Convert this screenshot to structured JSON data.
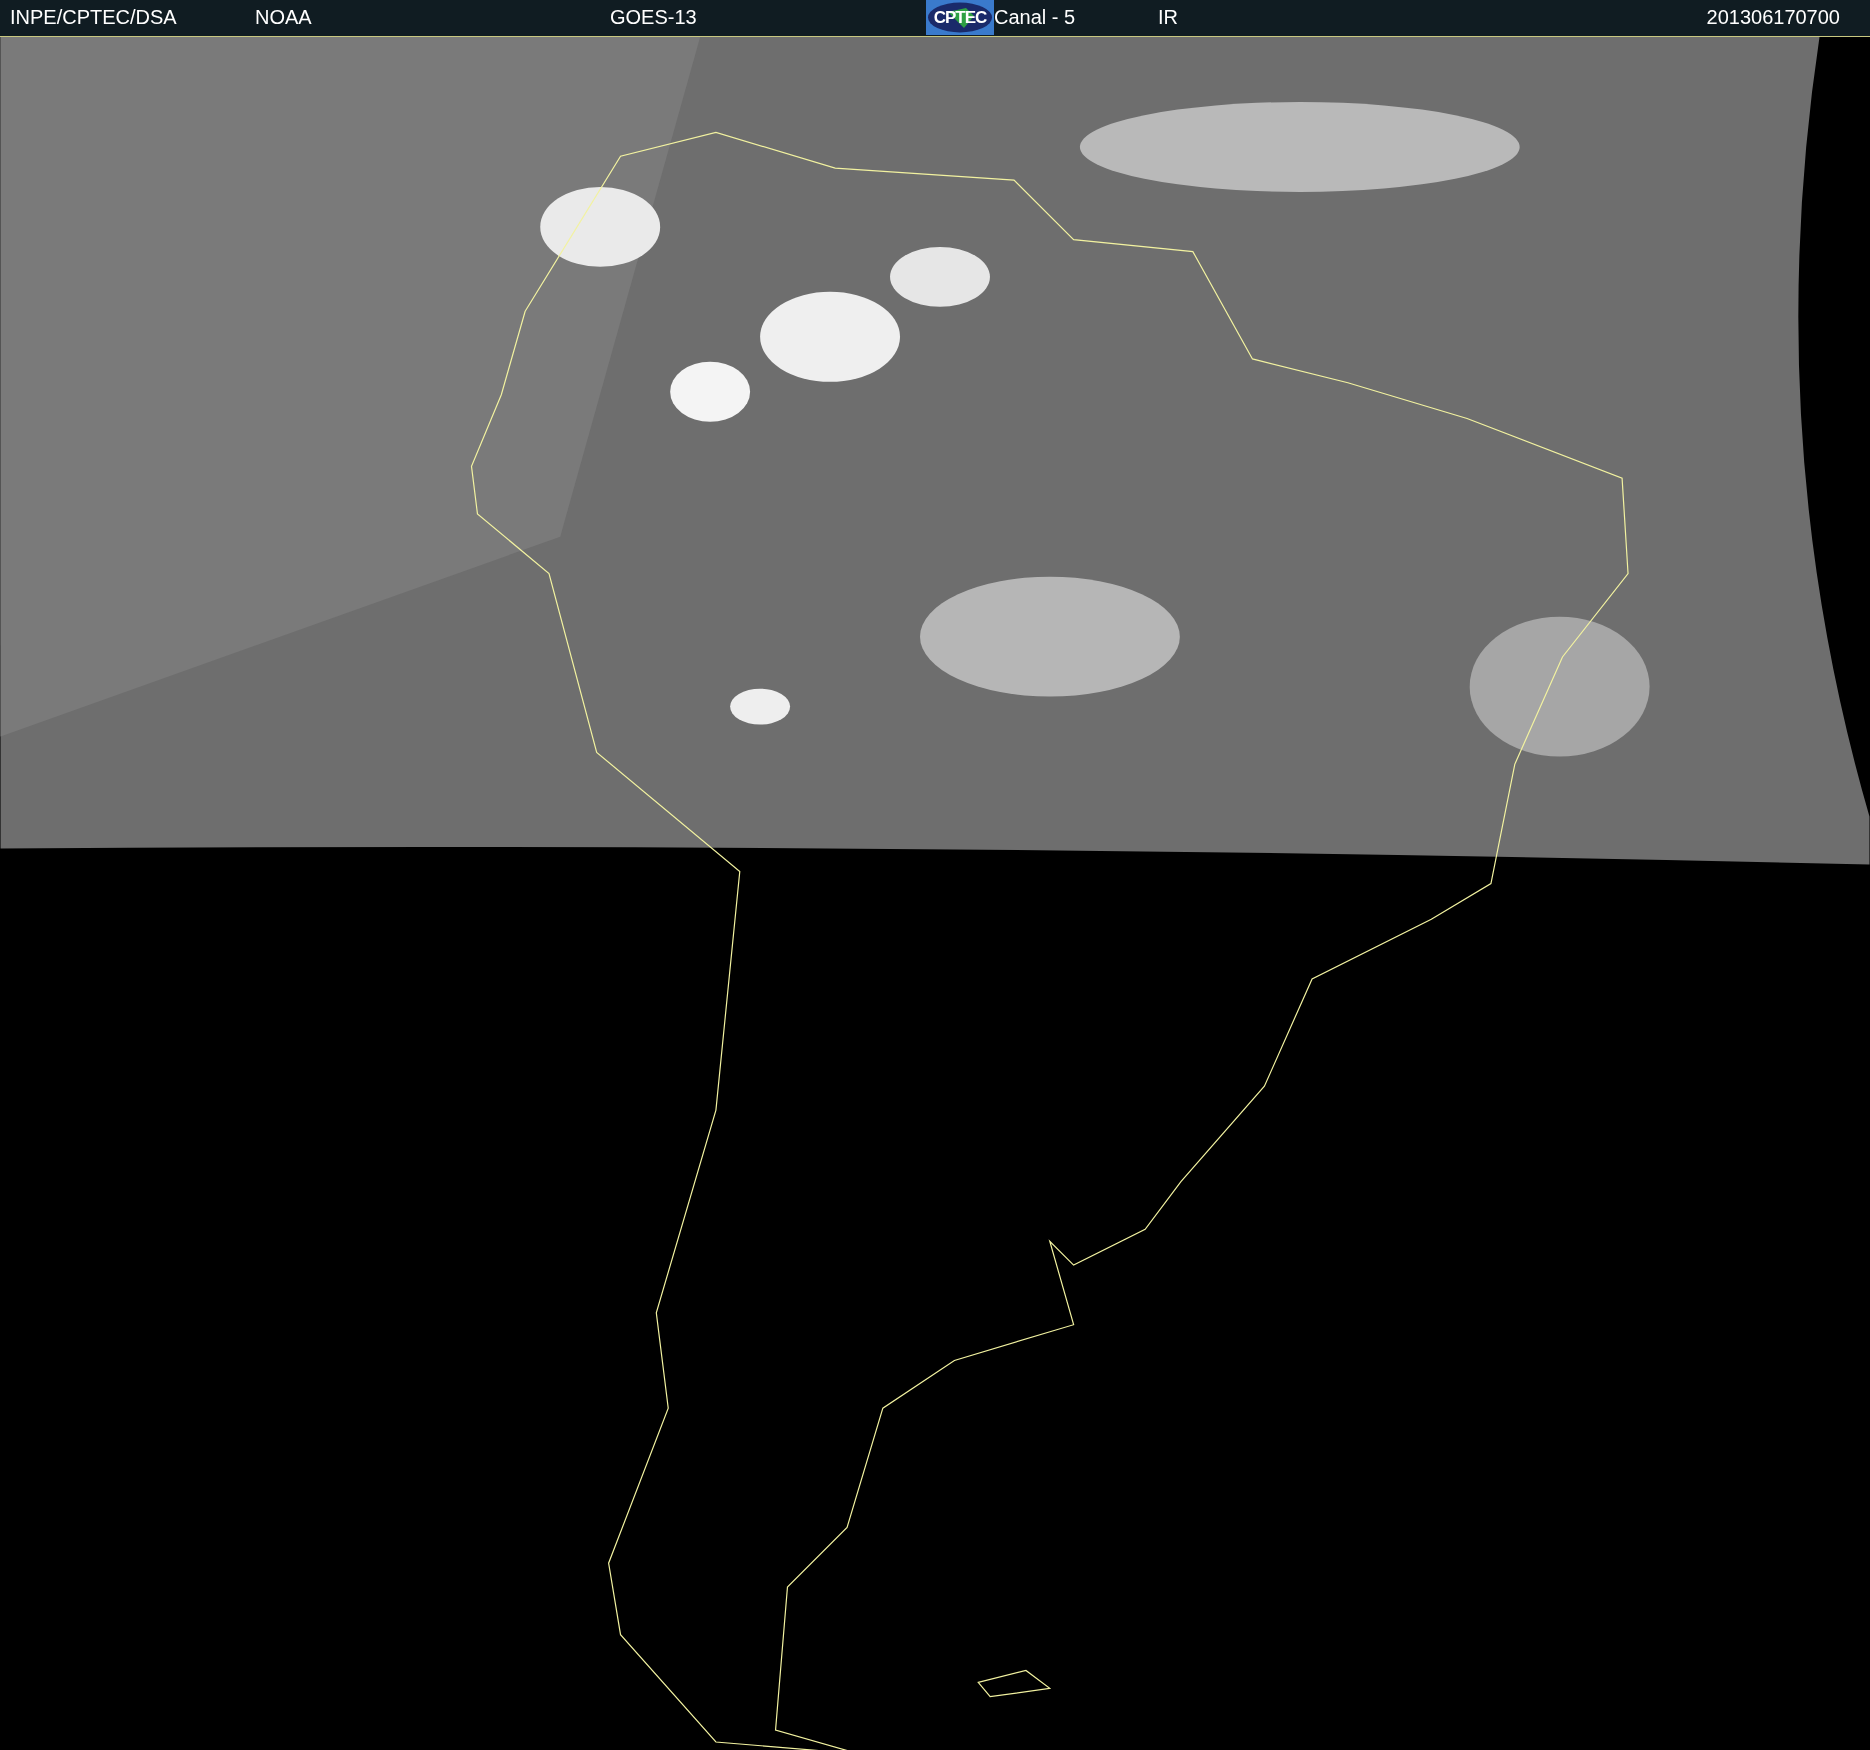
{
  "header": {
    "agency": "INPE/CPTEC/DSA",
    "source": "NOAA",
    "satellite": "GOES-13",
    "logo": "CPTEC",
    "channel": "Canal - 5",
    "band": "IR",
    "timestamp": "201306170700"
  }
}
